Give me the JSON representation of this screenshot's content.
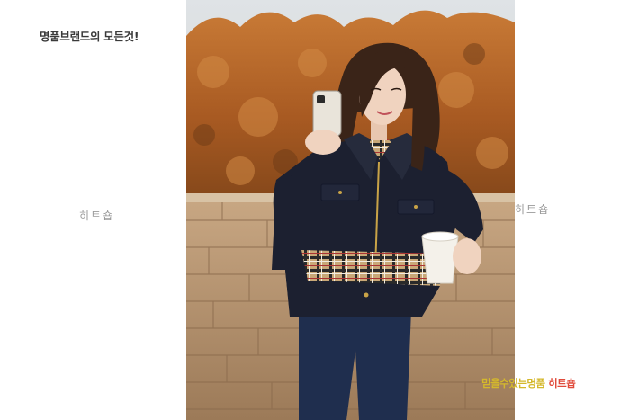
{
  "header": {
    "tagline": "명품브랜드의 모든것!"
  },
  "watermarks": {
    "left": "히트숍",
    "right": "히트숍"
  },
  "slogan": {
    "part1": "믿을수있는명품",
    "part2": "히트숍"
  },
  "colors": {
    "foliage": "#b5651d",
    "wall": "#b8926a",
    "jacket": "#1c2030",
    "slogan_yellow": "#d4b82c",
    "slogan_red": "#e04a3a"
  }
}
